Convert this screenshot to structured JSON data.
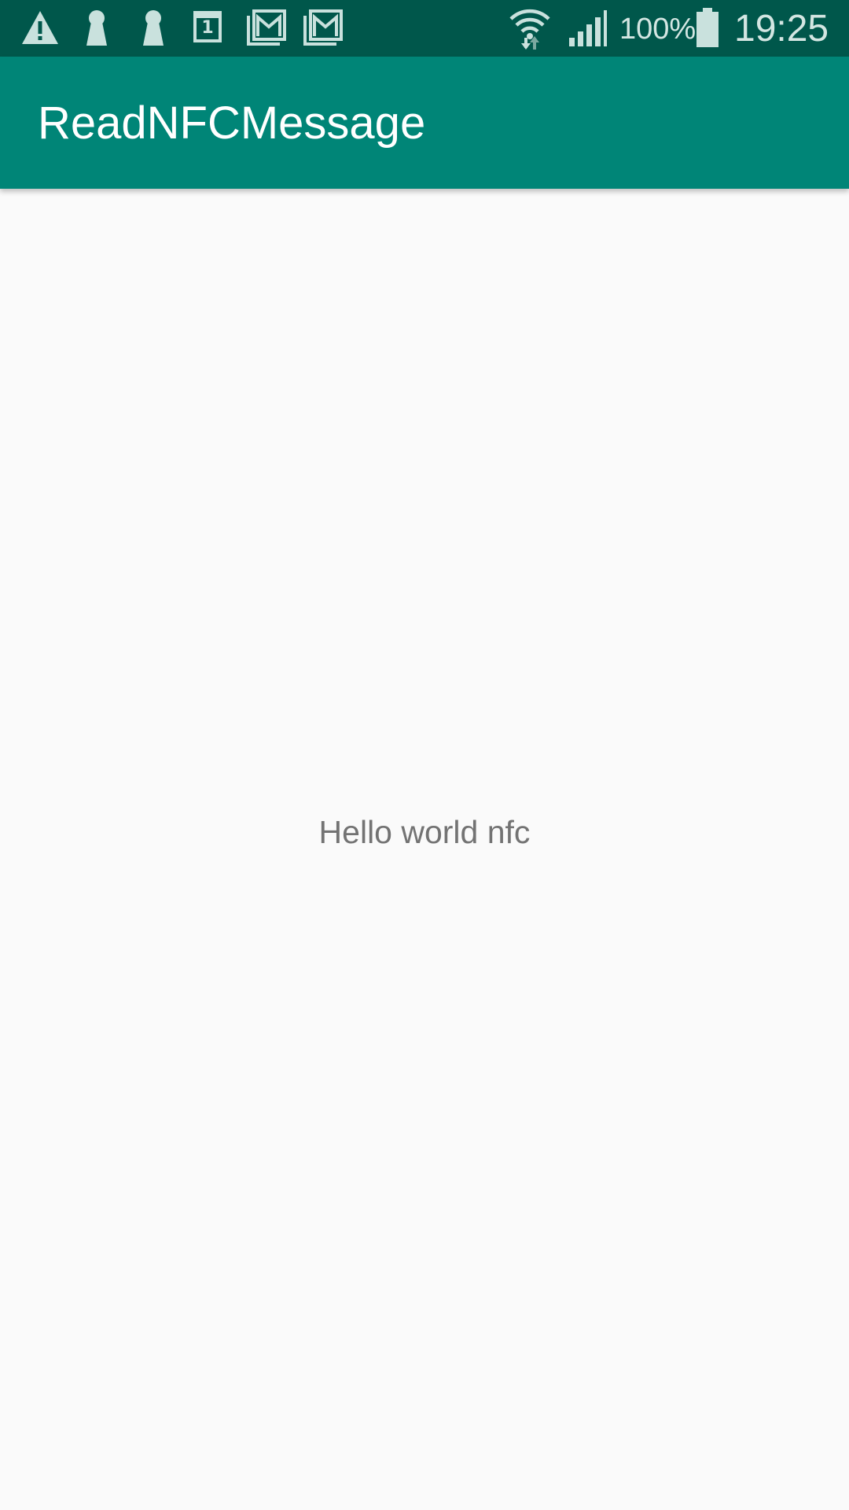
{
  "status_bar": {
    "left_icons": [
      "warning-icon",
      "keyhole-icon",
      "keyhole-icon",
      "calendar-icon",
      "gmail-icon",
      "gmail-icon"
    ],
    "calendar_day": "1",
    "right_icons": [
      "wifi-icon",
      "signal-icon",
      "battery-icon"
    ],
    "battery_percent": "100%",
    "time": "19:25",
    "colors": {
      "background": "#00574b",
      "icon": "#c9e1dd"
    }
  },
  "app_bar": {
    "title": "ReadNFCMessage",
    "color": "#008577"
  },
  "main": {
    "message": "Hello world nfc"
  }
}
